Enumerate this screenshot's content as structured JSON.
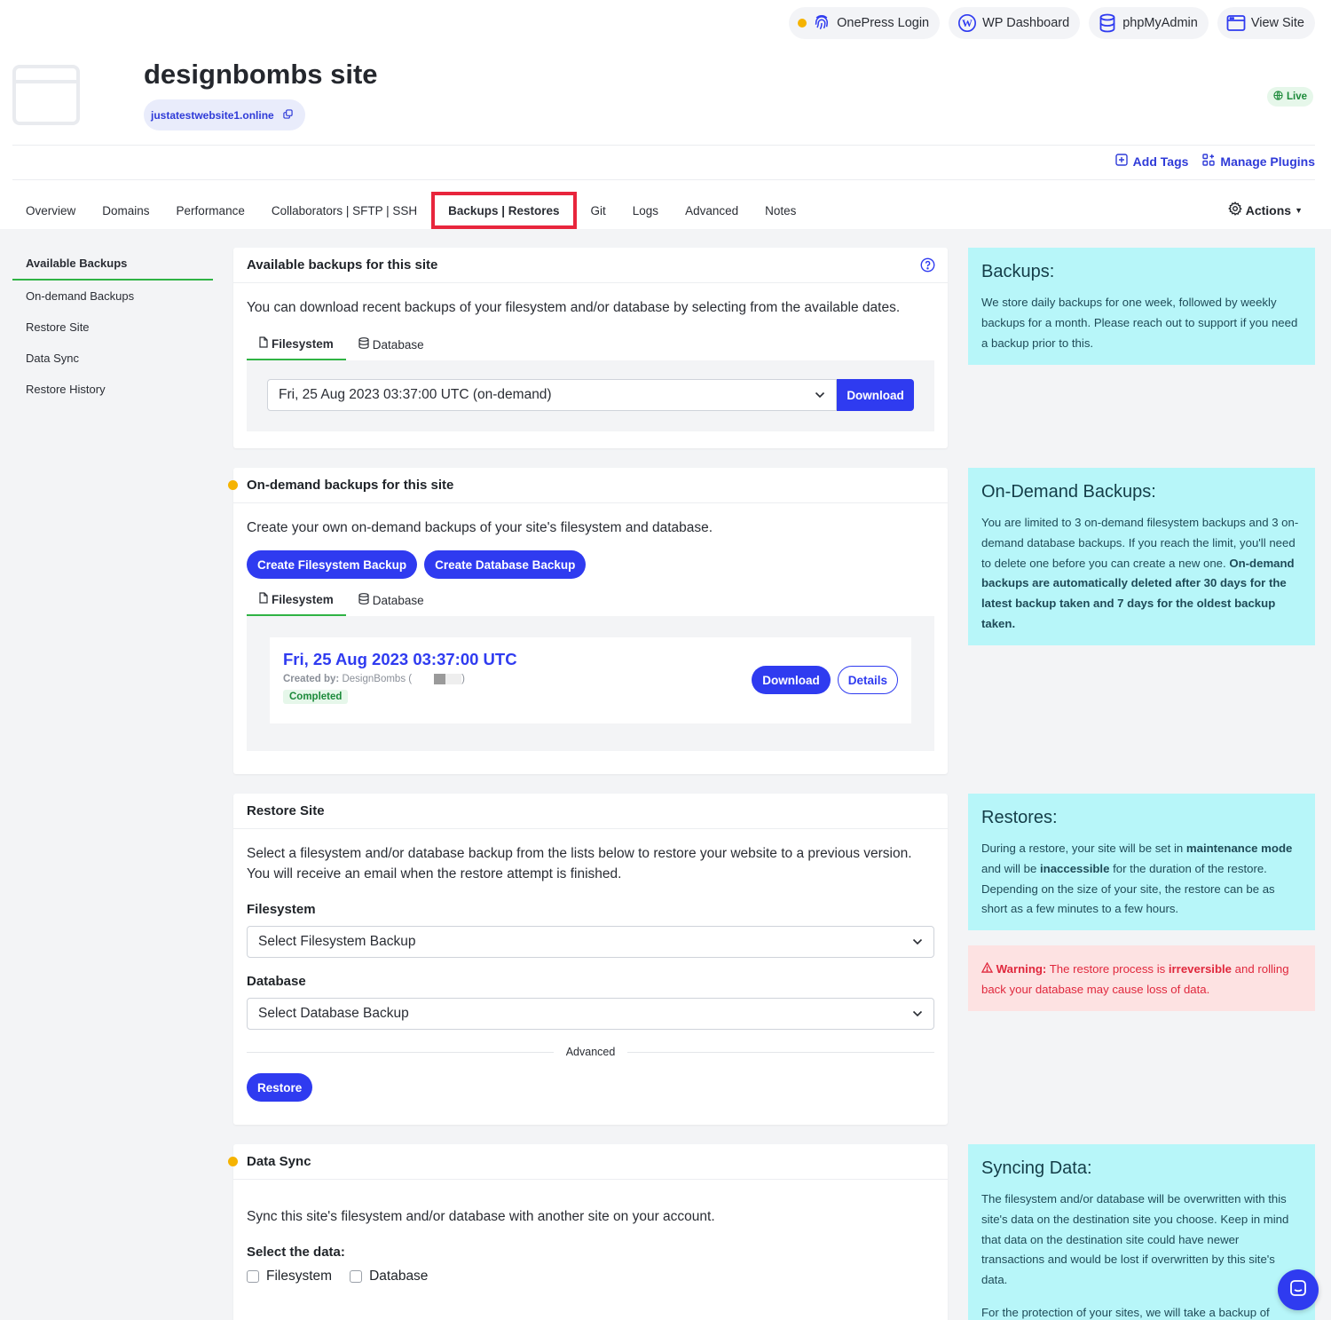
{
  "top_links": [
    {
      "label": "OnePress Login",
      "icon": "fingerprint-icon"
    },
    {
      "label": "WP Dashboard",
      "icon": "wordpress-icon"
    },
    {
      "label": "phpMyAdmin",
      "icon": "database-icon"
    },
    {
      "label": "View Site",
      "icon": "browser-window-icon"
    }
  ],
  "site": {
    "title": "designbombs site",
    "domain": "justatestwebsite1.online",
    "status": "Live"
  },
  "tools": {
    "add_tags": "Add Tags",
    "manage_plugins": "Manage Plugins"
  },
  "tabs": [
    "Overview",
    "Domains",
    "Performance",
    "Collaborators | SFTP | SSH",
    "Backups | Restores",
    "Git",
    "Logs",
    "Advanced",
    "Notes"
  ],
  "actions_label": "Actions",
  "sidenav": [
    "Available Backups",
    "On-demand Backups",
    "Restore Site",
    "Data Sync",
    "Restore History"
  ],
  "available": {
    "title": "Available backups for this site",
    "lead": "You can download recent backups of your filesystem and/or database by selecting from the available dates.",
    "tab_fs": "Filesystem",
    "tab_db": "Database",
    "selected": "Fri, 25 Aug 2023 03:37:00 UTC (on-demand)",
    "download": "Download"
  },
  "ondemand": {
    "title": "On-demand backups for this site",
    "lead": "Create your own on-demand backups of your site's filesystem and database.",
    "create_fs": "Create Filesystem Backup",
    "create_db": "Create Database Backup",
    "tab_fs": "Filesystem",
    "tab_db": "Database",
    "backup_date": "Fri, 25 Aug 2023 03:37:00 UTC",
    "created_by_label": "Created by:",
    "created_by_value": "DesignBombs (",
    "created_by_end": ")",
    "status": "Completed",
    "download": "Download",
    "details": "Details"
  },
  "restore": {
    "title": "Restore Site",
    "lead": "Select a filesystem and/or database backup from the lists below to restore your website to a previous version. You will receive an email when the restore attempt is finished.",
    "fs_label": "Filesystem",
    "fs_placeholder": "Select Filesystem Backup",
    "db_label": "Database",
    "db_placeholder": "Select Database Backup",
    "advanced": "Advanced",
    "button": "Restore"
  },
  "sync": {
    "title": "Data Sync",
    "lead": "Sync this site's filesystem and/or database with another site on your account.",
    "select_label": "Select the data:",
    "opt_fs": "Filesystem",
    "opt_db": "Database"
  },
  "info": {
    "backups_title": "Backups:",
    "backups_text": "We store daily backups for one week, followed by weekly backups for a month. Please reach out to support if you need a backup prior to this.",
    "ondemand_title": "On-Demand Backups:",
    "ondemand_text": "You are limited to 3 on-demand filesystem backups and 3 on-demand database backups. If you reach the limit, you'll need to delete one before you can create a new one. ",
    "ondemand_bold": "On-demand backups are automatically deleted after 30 days for the latest backup taken and 7 days for the oldest backup taken.",
    "restores_title": "Restores:",
    "restores_t1": "During a restore, your site will be set in ",
    "restores_b1": "maintenance mode",
    "restores_t2": " and will be ",
    "restores_b2": "inaccessible",
    "restores_t3": " for the duration of the restore. Depending on the size of your site, the restore can be as short as a few minutes to a few hours.",
    "warn_bold": "Warning:",
    "warn_t1": " The restore process is ",
    "warn_b2": "irreversible",
    "warn_t2": " and rolling back your database may cause loss of data.",
    "sync_title": "Syncing Data:",
    "sync_text": "The filesystem and/or database will be overwritten with this site's data on the destination site you choose. Keep in mind that data on the destination site could have newer transactions and would be lost if overwritten by this site's data.",
    "sync_text2": "For the protection of your sites, we will take a backup of"
  },
  "colors": {
    "accent": "#2f3bf0",
    "active_tab_border": "#e8253c",
    "info_bg": "#b7f6f9",
    "success": "#2fb344",
    "warning_bg": "#fde2e2"
  }
}
